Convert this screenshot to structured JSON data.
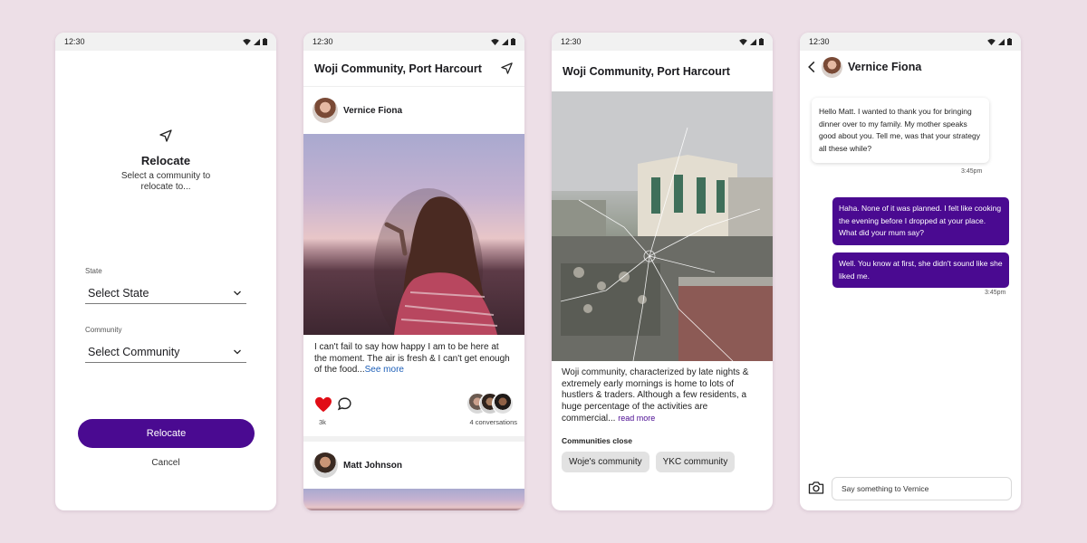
{
  "status": {
    "time": "12:30"
  },
  "relocate": {
    "title": "Relocate",
    "subtitle": "Select a community to relocate to...",
    "state_label": "State",
    "state_value": "Select State",
    "community_label": "Community",
    "community_value": "Select Community",
    "primary_button": "Relocate",
    "cancel_button": "Cancel",
    "icons": [
      "navigation-arrow-icon",
      "chevron-down-icon"
    ]
  },
  "feed": {
    "title": "Woji Community, Port Harcourt",
    "posts": [
      {
        "author": "Vernice Fiona",
        "text": "I can't fail to say how happy I am to be here at the moment. The air is fresh & I can't get enough of the food...",
        "see_more": "See more",
        "likes": "3k",
        "conversations": "4 conversations"
      },
      {
        "author": "Matt Johnson"
      }
    ],
    "colors": {
      "like": "#e10d16",
      "link": "#1d5fb8"
    }
  },
  "community": {
    "title": "Woji Community, Port Harcourt",
    "description": "Woji community, characterized by late nights & extremely early mornings is home to lots of hustlers & traders. Although a few residents, a huge percentage of the activities are commercial...",
    "read_more": "read more",
    "close_label": "Communities close",
    "chips": [
      "Woje's community",
      "YKC community"
    ]
  },
  "chat": {
    "name": "Vernice Fiona",
    "messages": [
      {
        "from": "them",
        "text": "Hello Matt. I wanted to thank you for bringing dinner over to my family. My mother speaks good about you. Tell me, was that your strategy all these while?",
        "time": "3:45pm"
      },
      {
        "from": "me",
        "text": "Haha. None of it was planned. I felt like cooking the evening before I dropped at your place. What did your mum say?"
      },
      {
        "from": "me",
        "text": "Well. You know at first, she didn't sound like she liked me.",
        "time": "3:45pm"
      }
    ],
    "placeholder": "Say something to Vernice"
  },
  "theme": {
    "primary": "#4a0a91",
    "background": "#eddfe7"
  }
}
